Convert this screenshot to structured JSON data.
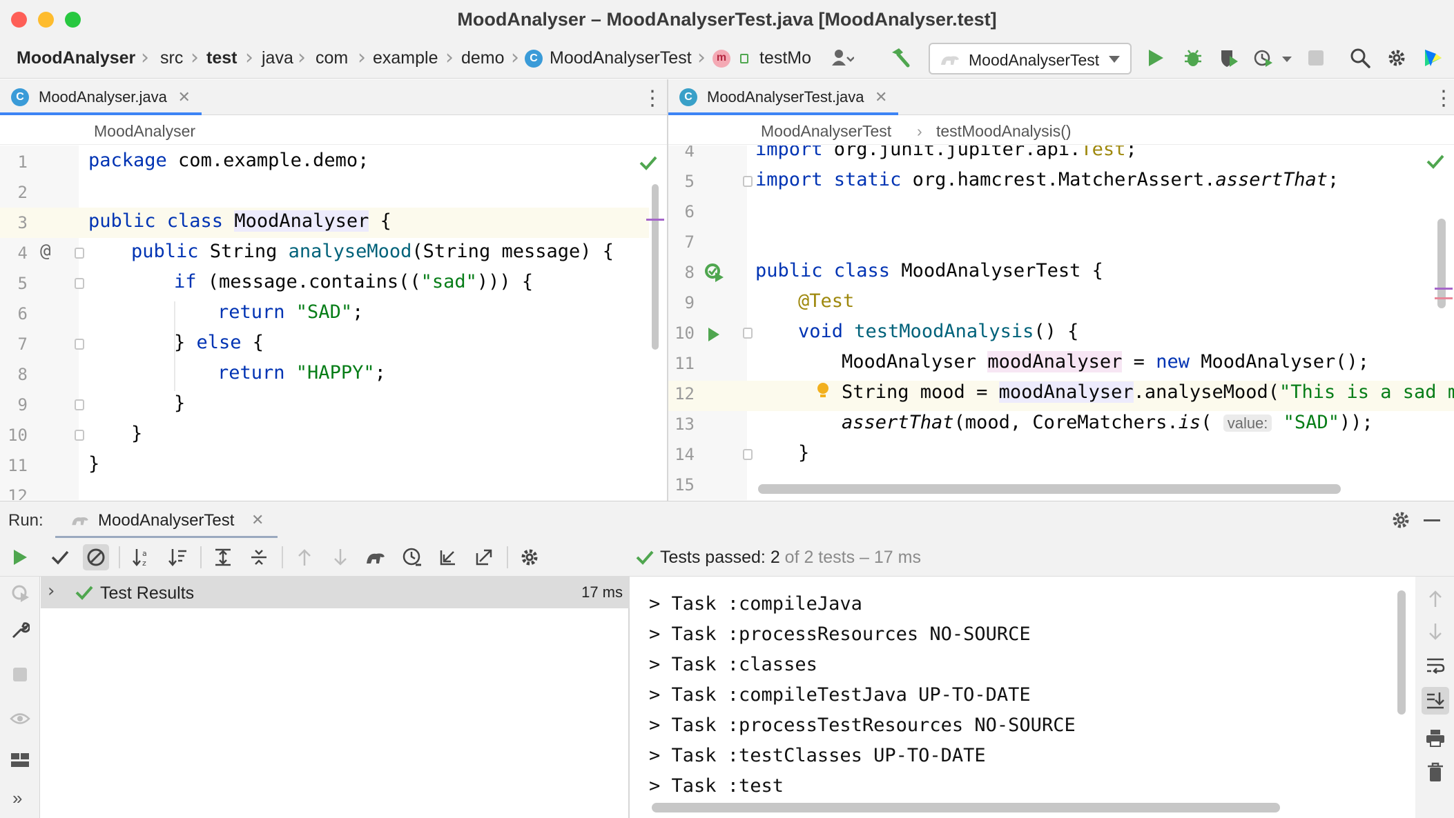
{
  "window": {
    "title": "MoodAnalyser – MoodAnalyserTest.java [MoodAnalyser.test]"
  },
  "breadcrumbs": [
    "MoodAnalyser",
    "src",
    "test",
    "java",
    "com",
    "example",
    "demo",
    "MoodAnalyserTest",
    "testMo"
  ],
  "toolbar": {
    "run_config": "MoodAnalyserTest"
  },
  "left_editor": {
    "tab_label": "MoodAnalyser.java",
    "file_icon_letter": "C",
    "crumb": "MoodAnalyser",
    "line_numbers": [
      "1",
      "2",
      "3",
      "4",
      "5",
      "6",
      "7",
      "8",
      "9",
      "10",
      "11",
      "12"
    ],
    "code": {
      "l1_kw": "package",
      "l1_rest": " com.example.demo;",
      "l3_kw": "public class ",
      "l3_cls": "MoodAnalyser",
      "l3_rest": " {",
      "l4_kw": "public ",
      "l4_type": "String ",
      "l4_fn": "analyseMood",
      "l4_rest": "(String message) {",
      "l5_kw": "if",
      "l5_rest": " (message.contains((",
      "l5_str": "\"sad\"",
      "l5_end": "))) {",
      "l6_kw": "return ",
      "l6_str": "\"SAD\"",
      "l6_end": ";",
      "l7_a": "} ",
      "l7_kw": "else",
      "l7_b": " {",
      "l8_kw": "return ",
      "l8_str": "\"HAPPY\"",
      "l8_end": ";",
      "l9": "}",
      "l10": "}",
      "l11": "}"
    },
    "gutter_marker": "@"
  },
  "right_editor": {
    "tab_label": "MoodAnalyserTest.java",
    "file_icon_letter": "C",
    "crumbs": [
      "MoodAnalyserTest",
      "testMoodAnalysis()"
    ],
    "line_numbers": [
      "4",
      "5",
      "6",
      "7",
      "8",
      "9",
      "10",
      "11",
      "12",
      "13",
      "14",
      "15"
    ],
    "code": {
      "l4_kw": "import ",
      "l4_rest": "org.junit.jupiter.api.",
      "l4_ann": "Test",
      "l4_end": ";",
      "l5_kw": "import static ",
      "l5_rest": "org.hamcrest.MatcherAssert.",
      "l5_it": "assertThat",
      "l5_end": ";",
      "l8_kw": "public class ",
      "l8_rest": "MoodAnalyserTest {",
      "l9_ann": "@Test",
      "l10_kw": "void ",
      "l10_fn": "testMoodAnalysis",
      "l10_rest": "() {",
      "l11_a": "MoodAnalyser ",
      "l11_var": "moodAnalyser",
      "l11_b": " = ",
      "l11_kw": "new",
      "l11_c": " MoodAnalyser();",
      "l12_a": "String mood = ",
      "l12_var": "moodAnalyser",
      "l12_b": ".analyseMood(",
      "l12_str": "\"This is a sad mes",
      "l13_it": "assertThat",
      "l13_a": "(mood, CoreMatchers.",
      "l13_it2": "is",
      "l13_b": "( ",
      "l13_inlay": "value:",
      "l13_str": " \"SAD\"",
      "l13_end": "));",
      "l14": "}"
    }
  },
  "run_panel": {
    "label": "Run:",
    "tab_label": "MoodAnalyserTest",
    "status_prefix": "Tests passed: ",
    "status_count": "2",
    "status_suffix": " of 2 tests – 17 ms",
    "results_root": "Test Results",
    "results_time": "17 ms",
    "console_lines": [
      "> Task :compileJava",
      "> Task :processResources NO-SOURCE",
      "> Task :classes",
      "> Task :compileTestJava UP-TO-DATE",
      "> Task :processTestResources NO-SOURCE",
      "> Task :testClasses UP-TO-DATE",
      "> Task :test"
    ],
    "more_tools": "»"
  },
  "colors": {
    "accent": "#3d84f5",
    "run_green": "#4fa64f",
    "keyword": "#0033b3",
    "string": "#067d17"
  }
}
